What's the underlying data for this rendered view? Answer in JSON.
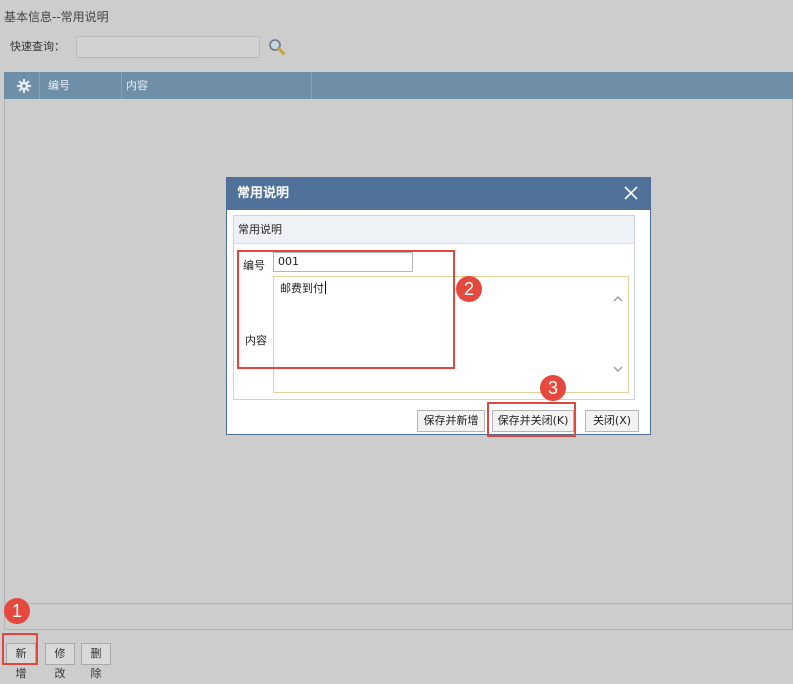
{
  "page": {
    "title": "基本信息--常用说明"
  },
  "search": {
    "label": "快速查询：",
    "value": "",
    "icon": "search-icon"
  },
  "grid": {
    "columns": [
      "编号",
      "内容"
    ],
    "settings_icon": "gear-icon"
  },
  "toolbar": {
    "add_label": "新增",
    "edit_label": "修改",
    "delete_label": "删除"
  },
  "dialog": {
    "title": "常用说明",
    "section_title": "常用说明",
    "code_label": "编号",
    "code_value": "001",
    "content_label": "内容",
    "content_value": "邮费到付",
    "buttons": {
      "save_new": "保存并新增",
      "save_close": "保存并关闭(K)",
      "close": "关闭(X)"
    }
  },
  "annotations": [
    "1",
    "2",
    "3"
  ],
  "colors": {
    "header_blue": "#6f8ea8",
    "dialog_title": "#50719a",
    "highlight_red": "#e0473d"
  }
}
